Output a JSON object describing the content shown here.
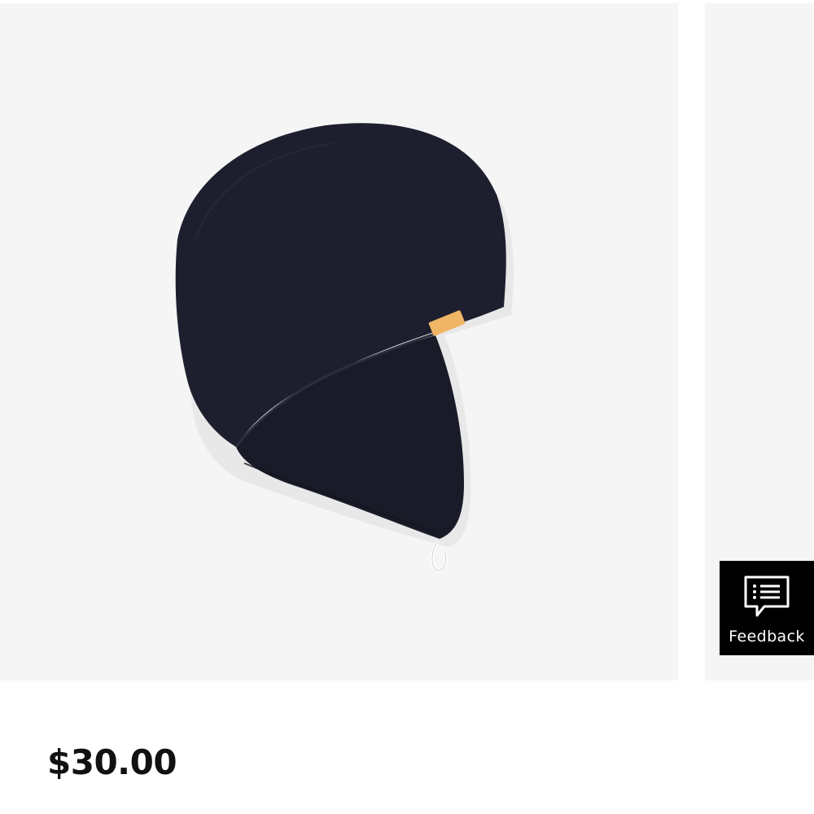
{
  "product": {
    "image_subject": "hair-towel-wrap-black",
    "price": "$30.00"
  },
  "feedback": {
    "label": "Feedback",
    "icon": "feedback-chat-icon"
  },
  "colors": {
    "image_background": "#f5f5f5",
    "towel": "#1e1f2e",
    "label_tag": "#f0b565",
    "feedback_background": "#000000"
  }
}
